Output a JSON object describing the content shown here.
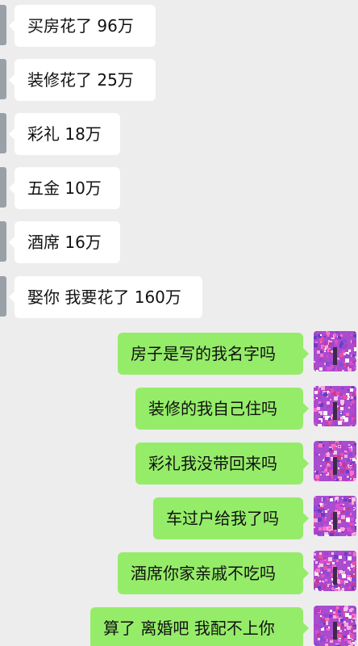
{
  "received": [
    {
      "text": "买房花了 96万"
    },
    {
      "text": "装修花了 25万"
    },
    {
      "text": "彩礼 18万"
    },
    {
      "text": "五金 10万"
    },
    {
      "text": "酒席 16万"
    },
    {
      "text": "娶你 我要花了 160万"
    }
  ],
  "sent": [
    {
      "text": "房子是写的我名字吗"
    },
    {
      "text": "装修的我自己住吗"
    },
    {
      "text": "彩礼我没带回来吗"
    },
    {
      "text": "车过户给我了吗"
    },
    {
      "text": "酒席你家亲戚不吃吗"
    },
    {
      "text": "算了 离婚吧 我配不上你"
    }
  ],
  "colors": {
    "background": "#ededed",
    "received_bubble": "#ffffff",
    "sent_bubble": "#95ec69"
  },
  "icons": {
    "self_avatar": "colorful-avatar-icon"
  }
}
